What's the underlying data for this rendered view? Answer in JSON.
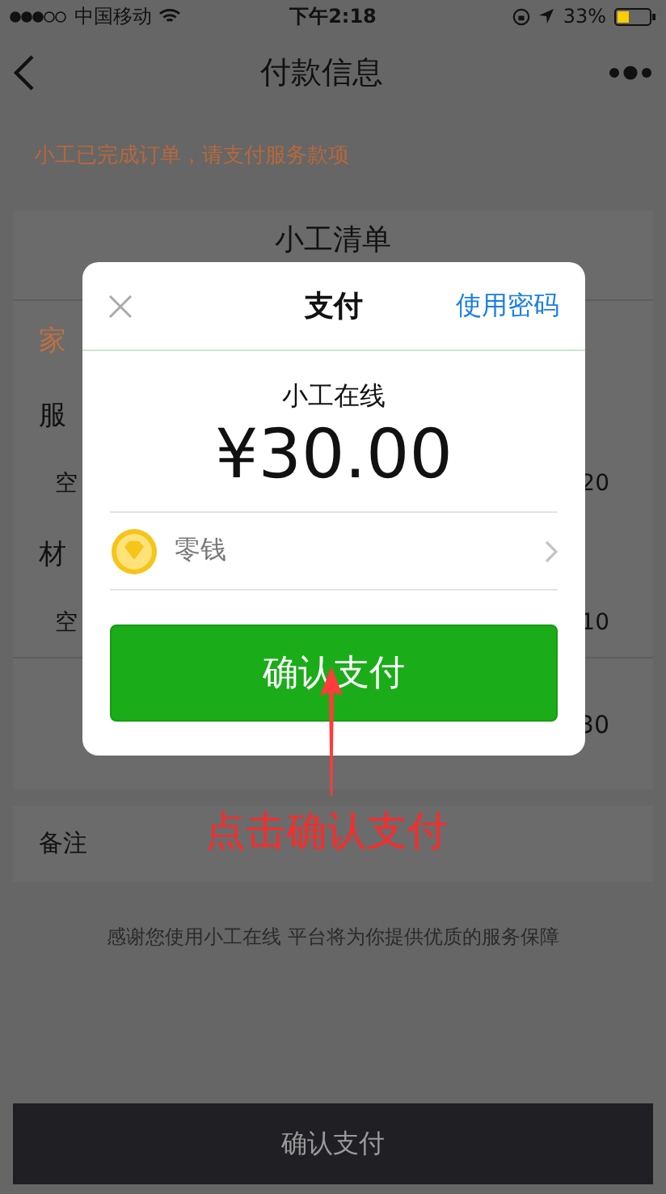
{
  "status_bar": {
    "carrier": "中国移动",
    "time": "下午2:18",
    "battery": "33%"
  },
  "nav": {
    "title": "付款信息"
  },
  "notice": "小工已完成订单，请支付服务款项",
  "order_card": {
    "title": "小工清单",
    "category": "家",
    "sections": [
      {
        "label": "服",
        "items": [
          {
            "name": "空",
            "price": "20"
          }
        ]
      },
      {
        "label": "材",
        "items": [
          {
            "name": "空",
            "price": "10"
          }
        ]
      }
    ],
    "total": "30"
  },
  "remarks": {
    "label": "备注"
  },
  "footer_note": "感谢您使用小工在线 平台将为你提供优质的服务保障",
  "bottom_bar": {
    "button": "确认支付"
  },
  "payment_dialog": {
    "title": "支付",
    "alt_action": "使用密码",
    "merchant": "小工在线",
    "amount": "¥30.00",
    "method": "零钱",
    "confirm": "确认支付"
  },
  "annotation": {
    "text": "点击确认支付"
  }
}
